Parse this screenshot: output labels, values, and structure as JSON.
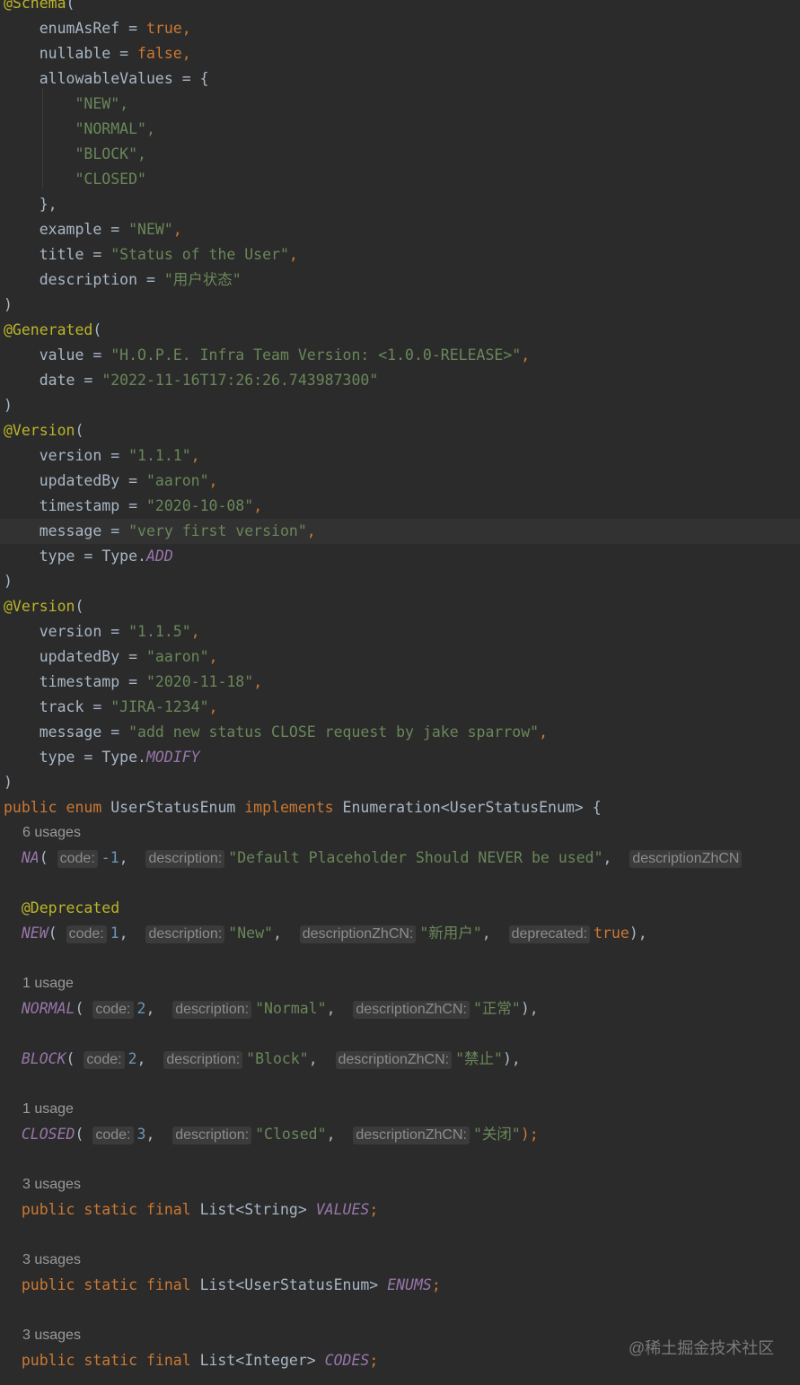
{
  "schema": {
    "annotation": "@Schema",
    "open": "(",
    "lines": [
      {
        "name": "enumAsRef",
        "eq": " = ",
        "value": "true",
        "tail": ","
      },
      {
        "name": "nullable",
        "eq": " = ",
        "value": "false",
        "tail": ","
      },
      {
        "name": "allowableValues",
        "eq": " = ",
        "brace": "{"
      }
    ],
    "allowable_values": [
      "\"NEW\",",
      "\"NORMAL\",",
      "\"BLOCK\",",
      "\"CLOSED\""
    ],
    "brace_close": "},",
    "example": {
      "name": "example",
      "eq": " = ",
      "value": "\"NEW\"",
      "tail": ","
    },
    "title": {
      "name": "title",
      "eq": " = ",
      "value": "\"Status of the User\"",
      "tail": ","
    },
    "description": {
      "name": "description",
      "eq": " = ",
      "value": "\"用户状态\""
    },
    "close": ")"
  },
  "generated": {
    "annotation": "@Generated",
    "open": "(",
    "value": {
      "name": "value",
      "eq": " = ",
      "value": "\"H.O.P.E. Infra Team Version: <1.0.0-RELEASE>\"",
      "tail": ","
    },
    "date": {
      "name": "date",
      "eq": " = ",
      "value": "\"2022-11-16T17:26:26.743987300\""
    },
    "close": ")"
  },
  "version1": {
    "annotation": "@Version",
    "open": "(",
    "version": {
      "name": "version",
      "eq": " = ",
      "value": "\"1.1.1\"",
      "tail": ","
    },
    "updatedBy": {
      "name": "updatedBy",
      "eq": " = ",
      "value": "\"aaron\"",
      "tail": ","
    },
    "timestamp": {
      "name": "timestamp",
      "eq": " = ",
      "value": "\"2020-10-08\"",
      "tail": ","
    },
    "message": {
      "name": "message",
      "eq": " = ",
      "value": "\"very first version\"",
      "tail": ","
    },
    "type": {
      "name": "type",
      "eq": " = ",
      "cls": "Type.",
      "const": "ADD"
    },
    "close": ")"
  },
  "version2": {
    "annotation": "@Version",
    "open": "(",
    "version": {
      "name": "version",
      "eq": " = ",
      "value": "\"1.1.5\"",
      "tail": ","
    },
    "updatedBy": {
      "name": "updatedBy",
      "eq": " = ",
      "value": "\"aaron\"",
      "tail": ","
    },
    "timestamp": {
      "name": "timestamp",
      "eq": " = ",
      "value": "\"2020-11-18\"",
      "tail": ","
    },
    "track": {
      "name": "track",
      "eq": " = ",
      "value": "\"JIRA-1234\"",
      "tail": ","
    },
    "message": {
      "name": "message",
      "eq": " = ",
      "value": "\"add new status CLOSE request by jake sparrow\"",
      "tail": ","
    },
    "type": {
      "name": "type",
      "eq": " = ",
      "cls": "Type.",
      "const": "MODIFY"
    },
    "close": ")"
  },
  "declaration": {
    "kw_public": "public",
    "kw_enum": "enum",
    "class_name": "UserStatusEnum",
    "kw_implements": "implements",
    "iface": "Enumeration<UserStatusEnum>",
    "brace": "{"
  },
  "constants": {
    "na": {
      "usages": "6 usages",
      "name": "NA",
      "code_hint": "code:",
      "code": "-1",
      "desc_hint": "description:",
      "desc": "\"Default Placeholder Should NEVER be used\"",
      "zh_hint": "descriptionZhCN"
    },
    "new": {
      "annotation": "@Deprecated",
      "name": "NEW",
      "code_hint": "code:",
      "code": "1",
      "desc_hint": "description:",
      "desc": "\"New\"",
      "zh_hint": "descriptionZhCN:",
      "zh": "\"新用户\"",
      "dep_hint": "deprecated:",
      "dep": "true",
      "end": "),"
    },
    "normal": {
      "usages": "1 usage",
      "name": "NORMAL",
      "code_hint": "code:",
      "code": "2",
      "desc_hint": "description:",
      "desc": "\"Normal\"",
      "zh_hint": "descriptionZhCN:",
      "zh": "\"正常\"",
      "end": "),"
    },
    "block": {
      "name": "BLOCK",
      "code_hint": "code:",
      "code": "2",
      "desc_hint": "description:",
      "desc": "\"Block\"",
      "zh_hint": "descriptionZhCN:",
      "zh": "\"禁止\"",
      "end": "),"
    },
    "closed": {
      "usages": "1 usage",
      "name": "CLOSED",
      "code_hint": "code:",
      "code": "3",
      "desc_hint": "description:",
      "desc": "\"Closed\"",
      "zh_hint": "descriptionZhCN:",
      "zh": "\"关闭\"",
      "end": ");"
    }
  },
  "fields": [
    {
      "usages": "3 usages",
      "mods": "public static final",
      "type": "List<String>",
      "name": "VALUES",
      "end": ";"
    },
    {
      "usages": "3 usages",
      "mods": "public static final",
      "type": "List<UserStatusEnum>",
      "name": "ENUMS",
      "end": ";"
    },
    {
      "usages": "3 usages",
      "mods": "public static final",
      "type": "List<Integer>",
      "name": "CODES",
      "end": ";"
    }
  ],
  "watermark": "@稀土掘金技术社区",
  "colors": {
    "background": "#2b2b2b",
    "annotation": "#bbb529",
    "string": "#6a8759",
    "keyword": "#cc7832",
    "number": "#6897bb",
    "constant": "#9876aa",
    "text": "#a9b7c6",
    "hint_bg": "#3b3b3b",
    "hint_text": "#8c8c8c"
  }
}
